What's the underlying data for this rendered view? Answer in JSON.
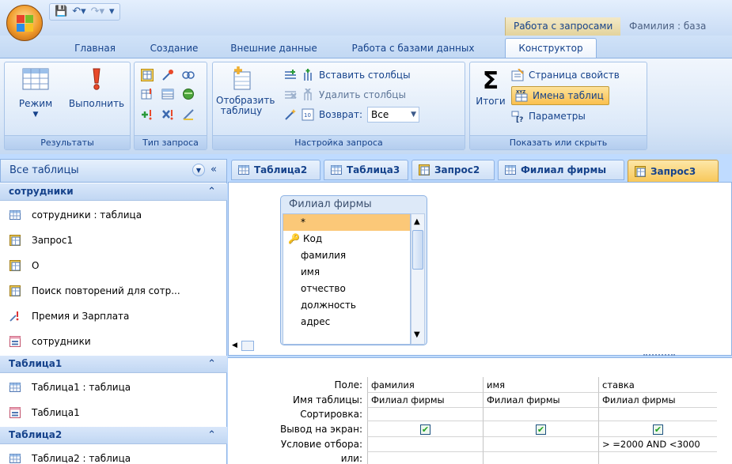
{
  "ribbon_tabs": [
    "Главная",
    "Создание",
    "Внешние данные",
    "Работа с базами данных"
  ],
  "active_tab": "Конструктор",
  "context_tab": "Работа с запросами",
  "title": "Фамилия : база",
  "groups": {
    "results": {
      "label": "Результаты",
      "run_mode": "Режим",
      "run": "Выполнить"
    },
    "query_type": {
      "label": "Тип запроса"
    },
    "setup": {
      "label": "Настройка запроса",
      "show_table": "Отобразить таблицу",
      "insert_cols": "Вставить столбцы",
      "delete_cols": "Удалить столбцы",
      "return_label": "Возврат:",
      "return_value": "Все"
    },
    "show_hide": {
      "label": "Показать или скрыть",
      "totals": "Итоги",
      "property_sheet": "Страница свойств",
      "table_names": "Имена таблиц",
      "parameters": "Параметры"
    }
  },
  "nav": {
    "header": "Все таблицы",
    "groups": [
      {
        "name": "сотрудники",
        "items": [
          {
            "label": "сотрудники : таблица",
            "icon": "table-icon"
          },
          {
            "label": "Запрос1",
            "icon": "query-icon"
          },
          {
            "label": "О",
            "icon": "query-icon"
          },
          {
            "label": "Поиск повторений для сотр...",
            "icon": "query-icon"
          },
          {
            "label": "Премия и Зарплата",
            "icon": "action-query-icon"
          },
          {
            "label": "сотрудники",
            "icon": "form-icon"
          }
        ]
      },
      {
        "name": "Таблица1",
        "items": [
          {
            "label": "Таблица1 : таблица",
            "icon": "table-icon"
          },
          {
            "label": "Таблица1",
            "icon": "form-icon"
          }
        ]
      },
      {
        "name": "Таблица2",
        "items": [
          {
            "label": "Таблица2 : таблица",
            "icon": "table-icon"
          }
        ]
      }
    ]
  },
  "doc_tabs": [
    {
      "label": "Таблица2",
      "icon": "table-icon",
      "active": false
    },
    {
      "label": "Таблица3",
      "icon": "table-icon",
      "active": false
    },
    {
      "label": "Запрос2",
      "icon": "query-icon",
      "active": false
    },
    {
      "label": "Филиал фирмы",
      "icon": "table-icon",
      "active": false
    },
    {
      "label": "Запрос3",
      "icon": "query-icon",
      "active": true
    }
  ],
  "field_list": {
    "title": "Филиал фирмы",
    "fields": [
      "*",
      "Код",
      "фамилия",
      "имя",
      "отчество",
      "должность",
      "адрес"
    ]
  },
  "grid": {
    "row_labels": [
      "Поле:",
      "Имя таблицы:",
      "Сортировка:",
      "Вывод на экран:",
      "Условие отбора:",
      "или:"
    ],
    "columns": [
      {
        "field": "фамилия",
        "table": "Филиал фирмы",
        "sort": "",
        "show": true,
        "criteria": ""
      },
      {
        "field": "имя",
        "table": "Филиал фирмы",
        "sort": "",
        "show": true,
        "criteria": ""
      },
      {
        "field": "ставка",
        "table": "Филиал фирмы",
        "sort": "",
        "show": true,
        "criteria": "> =2000 AND <3000"
      }
    ]
  }
}
